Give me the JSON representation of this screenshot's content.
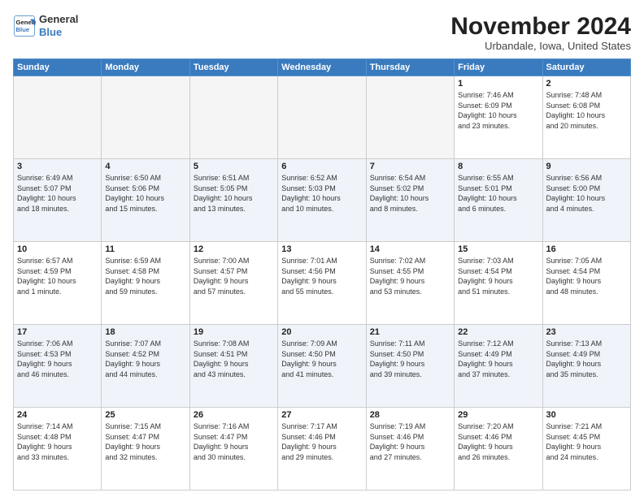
{
  "logo": {
    "line1": "General",
    "line2": "Blue"
  },
  "header": {
    "month": "November 2024",
    "location": "Urbandale, Iowa, United States"
  },
  "weekdays": [
    "Sunday",
    "Monday",
    "Tuesday",
    "Wednesday",
    "Thursday",
    "Friday",
    "Saturday"
  ],
  "weeks": [
    [
      {
        "day": "",
        "info": ""
      },
      {
        "day": "",
        "info": ""
      },
      {
        "day": "",
        "info": ""
      },
      {
        "day": "",
        "info": ""
      },
      {
        "day": "",
        "info": ""
      },
      {
        "day": "1",
        "info": "Sunrise: 7:46 AM\nSunset: 6:09 PM\nDaylight: 10 hours\nand 23 minutes."
      },
      {
        "day": "2",
        "info": "Sunrise: 7:48 AM\nSunset: 6:08 PM\nDaylight: 10 hours\nand 20 minutes."
      }
    ],
    [
      {
        "day": "3",
        "info": "Sunrise: 6:49 AM\nSunset: 5:07 PM\nDaylight: 10 hours\nand 18 minutes."
      },
      {
        "day": "4",
        "info": "Sunrise: 6:50 AM\nSunset: 5:06 PM\nDaylight: 10 hours\nand 15 minutes."
      },
      {
        "day": "5",
        "info": "Sunrise: 6:51 AM\nSunset: 5:05 PM\nDaylight: 10 hours\nand 13 minutes."
      },
      {
        "day": "6",
        "info": "Sunrise: 6:52 AM\nSunset: 5:03 PM\nDaylight: 10 hours\nand 10 minutes."
      },
      {
        "day": "7",
        "info": "Sunrise: 6:54 AM\nSunset: 5:02 PM\nDaylight: 10 hours\nand 8 minutes."
      },
      {
        "day": "8",
        "info": "Sunrise: 6:55 AM\nSunset: 5:01 PM\nDaylight: 10 hours\nand 6 minutes."
      },
      {
        "day": "9",
        "info": "Sunrise: 6:56 AM\nSunset: 5:00 PM\nDaylight: 10 hours\nand 4 minutes."
      }
    ],
    [
      {
        "day": "10",
        "info": "Sunrise: 6:57 AM\nSunset: 4:59 PM\nDaylight: 10 hours\nand 1 minute."
      },
      {
        "day": "11",
        "info": "Sunrise: 6:59 AM\nSunset: 4:58 PM\nDaylight: 9 hours\nand 59 minutes."
      },
      {
        "day": "12",
        "info": "Sunrise: 7:00 AM\nSunset: 4:57 PM\nDaylight: 9 hours\nand 57 minutes."
      },
      {
        "day": "13",
        "info": "Sunrise: 7:01 AM\nSunset: 4:56 PM\nDaylight: 9 hours\nand 55 minutes."
      },
      {
        "day": "14",
        "info": "Sunrise: 7:02 AM\nSunset: 4:55 PM\nDaylight: 9 hours\nand 53 minutes."
      },
      {
        "day": "15",
        "info": "Sunrise: 7:03 AM\nSunset: 4:54 PM\nDaylight: 9 hours\nand 51 minutes."
      },
      {
        "day": "16",
        "info": "Sunrise: 7:05 AM\nSunset: 4:54 PM\nDaylight: 9 hours\nand 48 minutes."
      }
    ],
    [
      {
        "day": "17",
        "info": "Sunrise: 7:06 AM\nSunset: 4:53 PM\nDaylight: 9 hours\nand 46 minutes."
      },
      {
        "day": "18",
        "info": "Sunrise: 7:07 AM\nSunset: 4:52 PM\nDaylight: 9 hours\nand 44 minutes."
      },
      {
        "day": "19",
        "info": "Sunrise: 7:08 AM\nSunset: 4:51 PM\nDaylight: 9 hours\nand 43 minutes."
      },
      {
        "day": "20",
        "info": "Sunrise: 7:09 AM\nSunset: 4:50 PM\nDaylight: 9 hours\nand 41 minutes."
      },
      {
        "day": "21",
        "info": "Sunrise: 7:11 AM\nSunset: 4:50 PM\nDaylight: 9 hours\nand 39 minutes."
      },
      {
        "day": "22",
        "info": "Sunrise: 7:12 AM\nSunset: 4:49 PM\nDaylight: 9 hours\nand 37 minutes."
      },
      {
        "day": "23",
        "info": "Sunrise: 7:13 AM\nSunset: 4:49 PM\nDaylight: 9 hours\nand 35 minutes."
      }
    ],
    [
      {
        "day": "24",
        "info": "Sunrise: 7:14 AM\nSunset: 4:48 PM\nDaylight: 9 hours\nand 33 minutes."
      },
      {
        "day": "25",
        "info": "Sunrise: 7:15 AM\nSunset: 4:47 PM\nDaylight: 9 hours\nand 32 minutes."
      },
      {
        "day": "26",
        "info": "Sunrise: 7:16 AM\nSunset: 4:47 PM\nDaylight: 9 hours\nand 30 minutes."
      },
      {
        "day": "27",
        "info": "Sunrise: 7:17 AM\nSunset: 4:46 PM\nDaylight: 9 hours\nand 29 minutes."
      },
      {
        "day": "28",
        "info": "Sunrise: 7:19 AM\nSunset: 4:46 PM\nDaylight: 9 hours\nand 27 minutes."
      },
      {
        "day": "29",
        "info": "Sunrise: 7:20 AM\nSunset: 4:46 PM\nDaylight: 9 hours\nand 26 minutes."
      },
      {
        "day": "30",
        "info": "Sunrise: 7:21 AM\nSunset: 4:45 PM\nDaylight: 9 hours\nand 24 minutes."
      }
    ]
  ]
}
